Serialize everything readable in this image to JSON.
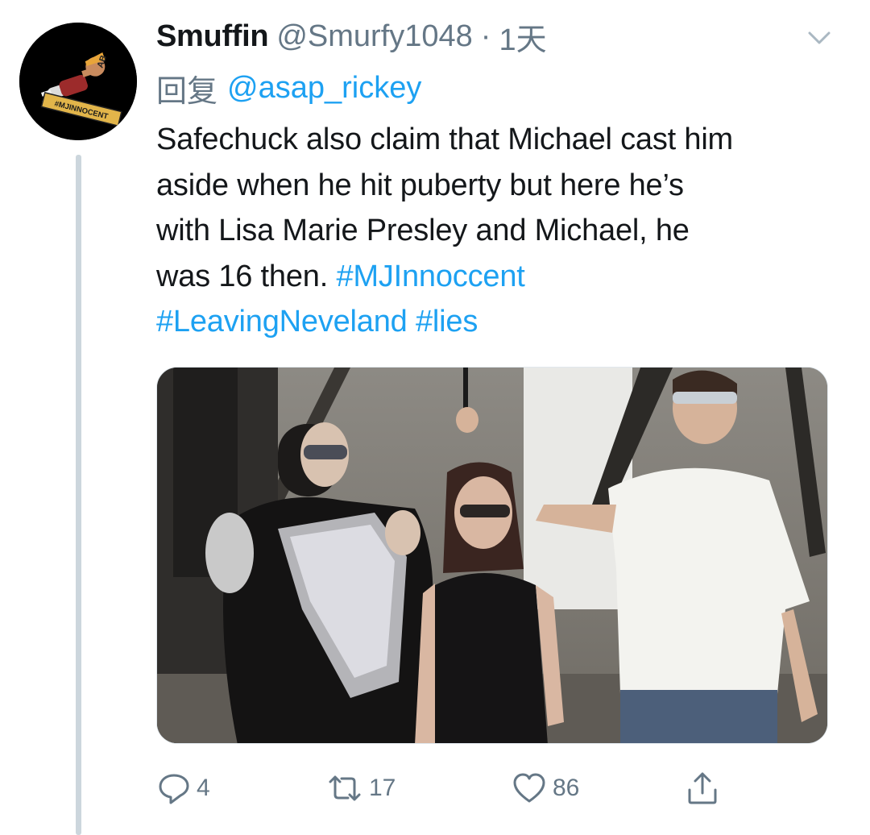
{
  "tweet": {
    "display_name": "Smuffin",
    "handle": "@Smurfy1048",
    "separator": "·",
    "time": "1天",
    "reply_label": "回复",
    "reply_to": "@asap_rickey",
    "text_lines": [
      "Safechuck also claim that Michael cast him",
      "aside when he hit puberty but here he’s",
      "with Lisa Marie Presley and Michael, he",
      "was 16 then."
    ],
    "hashtags": [
      "#MJInnoccent",
      "#LeavingNeveland",
      "#lies"
    ],
    "avatar_badge": "#MJINNOCENT",
    "avatar_cap_text": "AB"
  },
  "actions": {
    "replies": "4",
    "retweets": "17",
    "likes": "86"
  },
  "icons": {
    "menu": "chevron-down-icon",
    "reply": "reply-icon",
    "retweet": "retweet-icon",
    "like": "heart-icon",
    "share": "share-icon"
  },
  "colors": {
    "link": "#1da1f2",
    "secondary_text": "#657786",
    "primary_text": "#14171a",
    "thread_line": "#ccd6dd"
  }
}
